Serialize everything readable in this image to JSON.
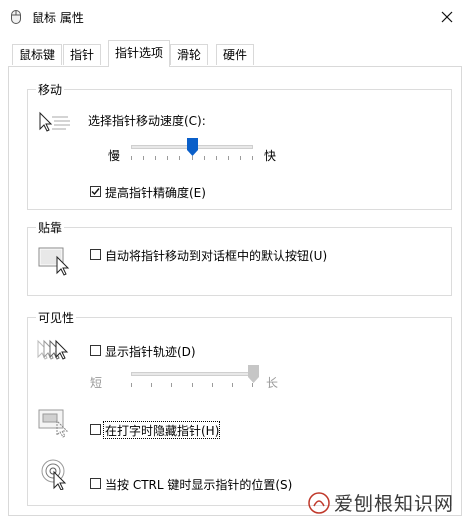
{
  "window": {
    "title": "鼠标 属性",
    "close_label": "✕"
  },
  "tabs": [
    {
      "label": "鼠标键",
      "active": false
    },
    {
      "label": "指针",
      "active": false
    },
    {
      "label": "指针选项",
      "active": true
    },
    {
      "label": "滑轮",
      "active": false
    },
    {
      "label": "硬件",
      "active": false
    }
  ],
  "motion": {
    "title": "移动",
    "speed_label": "选择指针移动速度(C):",
    "slow_label": "慢",
    "fast_label": "快",
    "speed_value": 0.5,
    "precision_label": "提高指针精确度(E)",
    "precision_checked": true
  },
  "snap": {
    "title": "贴靠",
    "snap_label": "自动将指针移动到对话框中的默认按钮(U)",
    "snap_checked": false
  },
  "visibility": {
    "title": "可见性",
    "trails_label": "显示指针轨迹(D)",
    "trails_checked": false,
    "short_label": "短",
    "long_label": "长",
    "trails_value": 1.0,
    "hide_label": "在打字时隐藏指针(H)",
    "hide_checked": false,
    "ctrl_label": "当按 CTRL 键时显示指针的位置(S)",
    "ctrl_checked": false
  },
  "watermark": {
    "text": "爱刨根知识网"
  },
  "colors": {
    "accent": "#0a5fc9",
    "border": "#d9d9d9",
    "disabled": "#9a9a9a"
  }
}
